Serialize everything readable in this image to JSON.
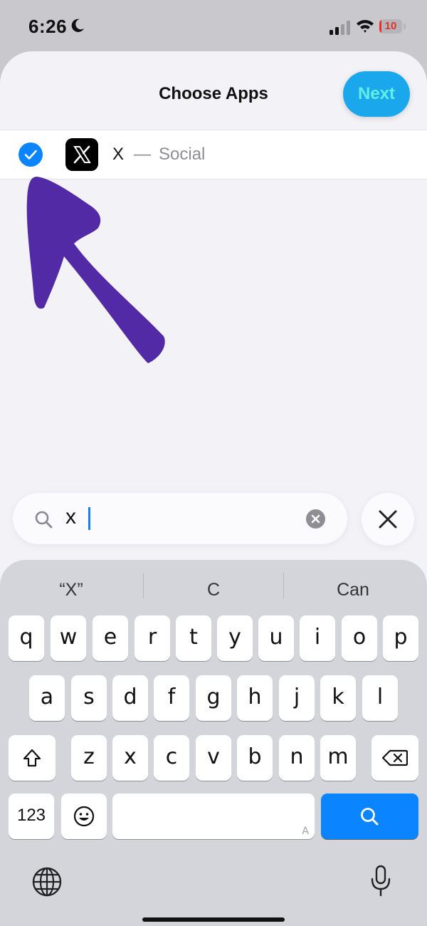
{
  "status_bar": {
    "time": "6:26",
    "battery_level": "10",
    "icons": [
      "moon-icon",
      "signal-icon",
      "wifi-icon",
      "battery-icon"
    ]
  },
  "header": {
    "title": "Choose Apps",
    "next_label": "Next"
  },
  "app_row": {
    "name": "X",
    "separator": "—",
    "category": "Social",
    "selected": true,
    "icons": [
      "checkmark-icon",
      "x-app-icon"
    ]
  },
  "annotation": {
    "icon": "hand-drawn-arrow-icon",
    "color": "#4a1fa0"
  },
  "search": {
    "value": "x",
    "icons": [
      "search-icon",
      "clear-icon",
      "close-icon"
    ]
  },
  "keyboard": {
    "suggestions": [
      "“X”",
      "C",
      "Can"
    ],
    "row1": [
      "q",
      "w",
      "e",
      "r",
      "t",
      "y",
      "u",
      "i",
      "o",
      "p"
    ],
    "row2": [
      "a",
      "s",
      "d",
      "f",
      "g",
      "h",
      "j",
      "k",
      "l"
    ],
    "row3": [
      "z",
      "x",
      "c",
      "v",
      "b",
      "n",
      "m"
    ],
    "numbers_label": "123",
    "space_hint": "A",
    "icons": [
      "shift-icon",
      "backspace-icon",
      "emoji-icon",
      "search-key-icon",
      "globe-icon",
      "microphone-icon"
    ]
  },
  "colors": {
    "accent": "#0a84ff",
    "next_button": "#1aa7ec",
    "next_text": "#5ff0e6",
    "battery_low": "#e0312b",
    "sheet_background": "#f2f2f7"
  }
}
